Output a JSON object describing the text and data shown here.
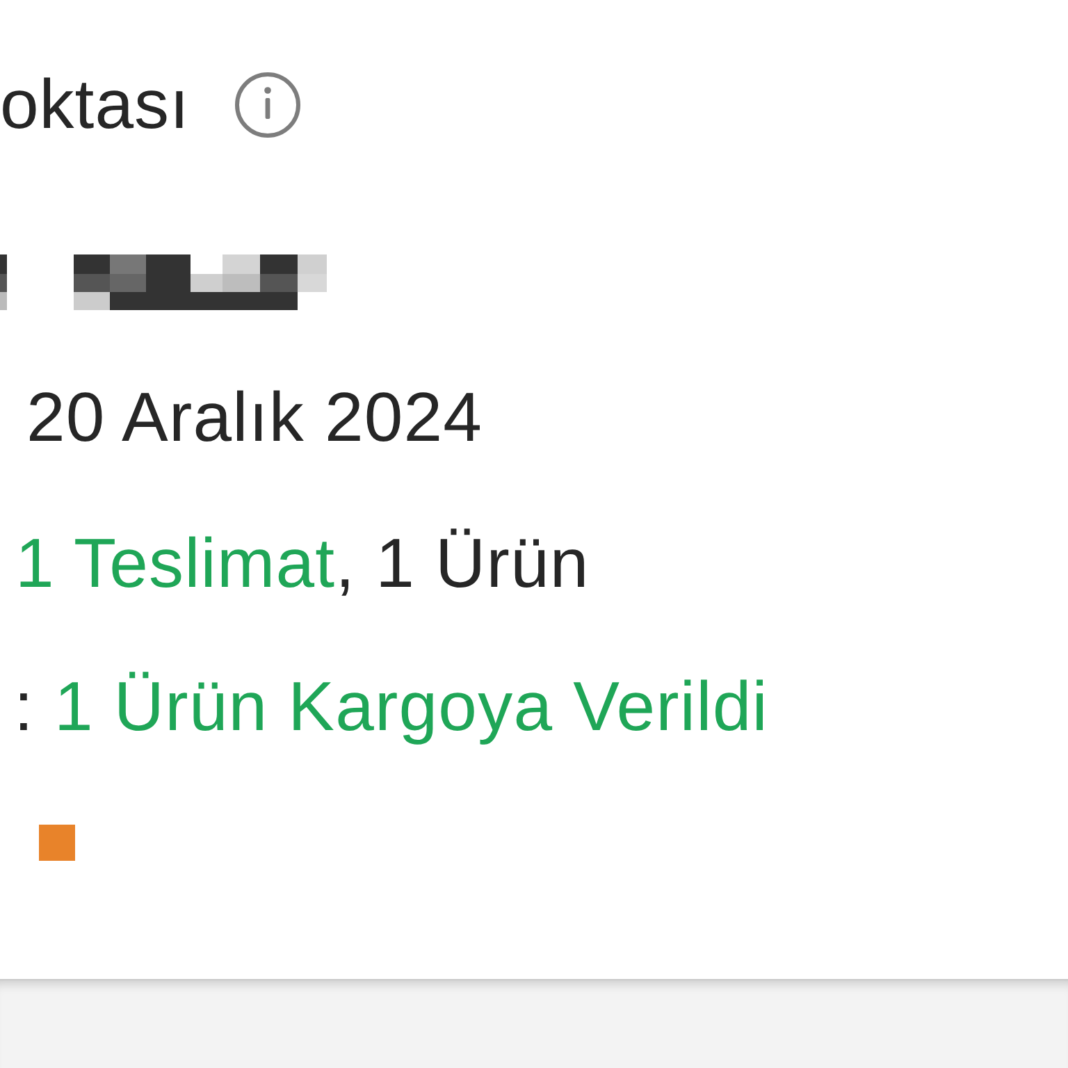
{
  "header": {
    "title": "oktası"
  },
  "date": "20 Aralık 2024",
  "summary": [
    {
      "text": "1 Teslimat",
      "highlighted": true
    },
    {
      "text": ", 1 Ürün",
      "highlighted": false
    }
  ],
  "status": {
    "label": ":",
    "value": "1 Ürün Kargoya Verildi"
  }
}
